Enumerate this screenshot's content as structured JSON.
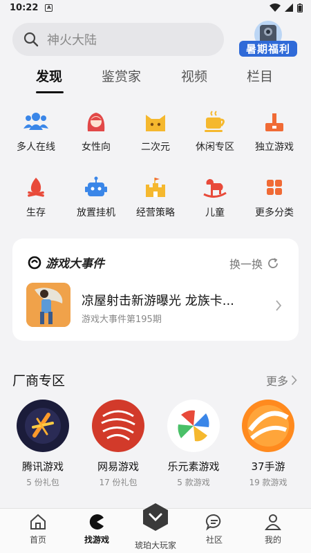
{
  "status_bar": {
    "time": "10:22",
    "sim_letter": "A"
  },
  "search": {
    "placeholder": "神火大陆"
  },
  "promo": {
    "label": "暑期福利"
  },
  "tabs": [
    {
      "label": "发现",
      "active": true
    },
    {
      "label": "鉴赏家",
      "active": false
    },
    {
      "label": "视频",
      "active": false
    },
    {
      "label": "栏目",
      "active": false
    }
  ],
  "categories": [
    {
      "label": "多人在线",
      "icon": "people-icon",
      "color": "#3a86e8"
    },
    {
      "label": "女性向",
      "icon": "girl-icon",
      "color": "#e24848"
    },
    {
      "label": "二次元",
      "icon": "cat-icon",
      "color": "#f5b82e"
    },
    {
      "label": "休闲专区",
      "icon": "coffee-icon",
      "color": "#f5b82e"
    },
    {
      "label": "独立游戏",
      "icon": "joystick-icon",
      "color": "#f06a35"
    },
    {
      "label": "生存",
      "icon": "campfire-icon",
      "color": "#e84a3a"
    },
    {
      "label": "放置挂机",
      "icon": "robot-icon",
      "color": "#3a86e8"
    },
    {
      "label": "经营策略",
      "icon": "castle-icon",
      "color": "#f5b82e"
    },
    {
      "label": "儿童",
      "icon": "rocking-horse-icon",
      "color": "#e84a3a"
    },
    {
      "label": "更多分类",
      "icon": "grid-icon",
      "color": "#f06a35"
    }
  ],
  "event_card": {
    "logo_text": "游戏大事件",
    "switch_label": "换一换",
    "title": "凉屋射击新游曝光 龙族卡...",
    "subtitle": "游戏大事件第195期"
  },
  "vendors": {
    "heading": "厂商专区",
    "more_label": "更多",
    "items": [
      {
        "name": "腾讯游戏",
        "count": "5 份礼包"
      },
      {
        "name": "网易游戏",
        "count": "17 份礼包"
      },
      {
        "name": "乐元素游戏",
        "count": "5 款游戏"
      },
      {
        "name": "37手游",
        "count": "19 款游戏"
      }
    ]
  },
  "bottom_nav": [
    {
      "label": "首页",
      "icon": "home-icon",
      "active": false
    },
    {
      "label": "找游戏",
      "icon": "pacman-icon",
      "active": true
    },
    {
      "label": "琥珀大玩家",
      "icon": "amber-hex-icon",
      "active": false
    },
    {
      "label": "社区",
      "icon": "chat-icon",
      "active": false
    },
    {
      "label": "我的",
      "icon": "person-icon",
      "active": false
    }
  ]
}
